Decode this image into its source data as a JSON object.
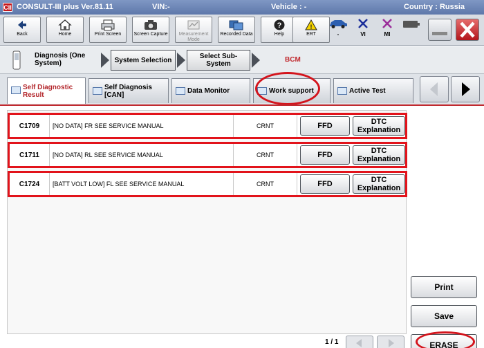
{
  "titlebar": {
    "logo": "CII",
    "app": "CONSULT-III plus  Ver.81.11",
    "vin": "VIN:-",
    "vehicle": "Vehicle : -",
    "country": "Country : Russia"
  },
  "toolbar": {
    "back": "Back",
    "home": "Home",
    "print_screen": "Print Screen",
    "screen_capture": "Screen Capture",
    "measurement_mode": "Measurement Mode",
    "recorded_data": "Recorded Data",
    "help": "Help",
    "ert": "ERT",
    "status_dash": "-",
    "status_vi": "VI",
    "status_mi": "MI"
  },
  "breadcrumb": {
    "diagnosis": "Diagnosis (One System)",
    "system_selection": "System Selection",
    "select_sub_system": "Select Sub-System",
    "current": "BCM"
  },
  "tabs": [
    {
      "label": "Self Diagnostic Result"
    },
    {
      "label": "Self Diagnosis [CAN]"
    },
    {
      "label": "Data Monitor"
    },
    {
      "label": "Work support"
    },
    {
      "label": "Active Test"
    }
  ],
  "dtc_rows": [
    {
      "code": "C1709",
      "description": "[NO DATA] FR SEE SERVICE MANUAL",
      "status": "CRNT",
      "ffd": "FFD",
      "explain": "DTC Explanation"
    },
    {
      "code": "C1711",
      "description": "[NO DATA] RL  SEE SERVICE MANUAL",
      "status": "CRNT",
      "ffd": "FFD",
      "explain": "DTC Explanation"
    },
    {
      "code": "C1724",
      "description": "[BATT VOLT LOW] FL SEE SERVICE MANUAL",
      "status": "CRNT",
      "ffd": "FFD",
      "explain": "DTC Explanation"
    }
  ],
  "side": {
    "print": "Print",
    "save": "Save",
    "erase": "ERASE"
  },
  "pager": {
    "page": "1 / 1"
  },
  "colors": {
    "accent_red": "#d3141c",
    "title_blue": "#5e78aa",
    "tab_active_text": "#b3262b"
  }
}
